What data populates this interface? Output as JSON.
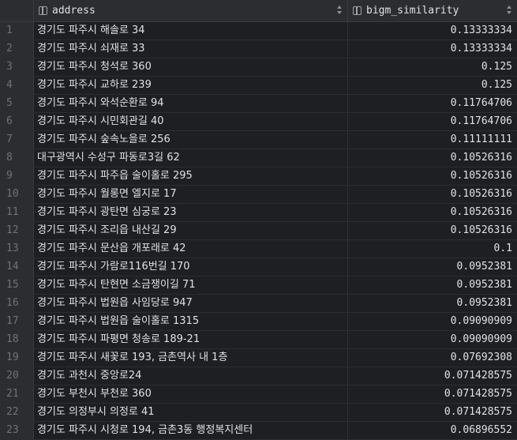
{
  "table": {
    "columns": [
      {
        "name": "address",
        "icon": "column-icon"
      },
      {
        "name": "bigm_similarity",
        "icon": "column-icon"
      }
    ],
    "rows": [
      {
        "n": "1",
        "address": "경기도 파주시 해솔로 34",
        "sim": "0.13333334"
      },
      {
        "n": "2",
        "address": "경기도 파주시 쇠재로 33",
        "sim": "0.13333334"
      },
      {
        "n": "3",
        "address": "경기도 파주시 청석로 360",
        "sim": "0.125"
      },
      {
        "n": "4",
        "address": "경기도 파주시 교하로 239",
        "sim": "0.125"
      },
      {
        "n": "5",
        "address": "경기도 파주시 와석순환로 94",
        "sim": "0.11764706"
      },
      {
        "n": "6",
        "address": "경기도 파주시 시민회관길 40",
        "sim": "0.11764706"
      },
      {
        "n": "7",
        "address": "경기도 파주시 숲속노을로 256",
        "sim": "0.11111111"
      },
      {
        "n": "8",
        "address": "대구광역시 수성구 파동로3길 62",
        "sim": "0.10526316"
      },
      {
        "n": "9",
        "address": "경기도 파주시 파주읍 술이홀로 295",
        "sim": "0.10526316"
      },
      {
        "n": "10",
        "address": "경기도 파주시 월롱면 엘지로 17",
        "sim": "0.10526316"
      },
      {
        "n": "11",
        "address": "경기도 파주시 광탄면 심궁로 23",
        "sim": "0.10526316"
      },
      {
        "n": "12",
        "address": "경기도 파주시 조리읍 내산길 29",
        "sim": "0.10526316"
      },
      {
        "n": "13",
        "address": "경기도 파주시 문산읍 개포래로 42",
        "sim": "0.1"
      },
      {
        "n": "14",
        "address": "경기도 파주시 가람로116번길 170",
        "sim": "0.0952381"
      },
      {
        "n": "15",
        "address": "경기도 파주시 탄현면 소금쟁이길 71",
        "sim": "0.0952381"
      },
      {
        "n": "16",
        "address": "경기도 파주시 법원읍 사임당로 947",
        "sim": "0.0952381"
      },
      {
        "n": "17",
        "address": "경기도 파주시 법원읍 술이홀로 1315",
        "sim": "0.09090909"
      },
      {
        "n": "18",
        "address": "경기도 파주시 파평면 청송로 189-21",
        "sim": "0.09090909"
      },
      {
        "n": "19",
        "address": "경기도 파주시 새꽃로 193, 금촌역사 내 1층",
        "sim": "0.07692308"
      },
      {
        "n": "20",
        "address": "경기도 과천시 중앙로24",
        "sim": "0.071428575"
      },
      {
        "n": "21",
        "address": "경기도 부천시 부천로 360",
        "sim": "0.071428575"
      },
      {
        "n": "22",
        "address": "경기도 의정부시 의정로 41",
        "sim": "0.071428575"
      },
      {
        "n": "23",
        "address": "경기도 파주시 시청로 194, 금촌3동 행정복지센터",
        "sim": "0.06896552"
      }
    ]
  }
}
